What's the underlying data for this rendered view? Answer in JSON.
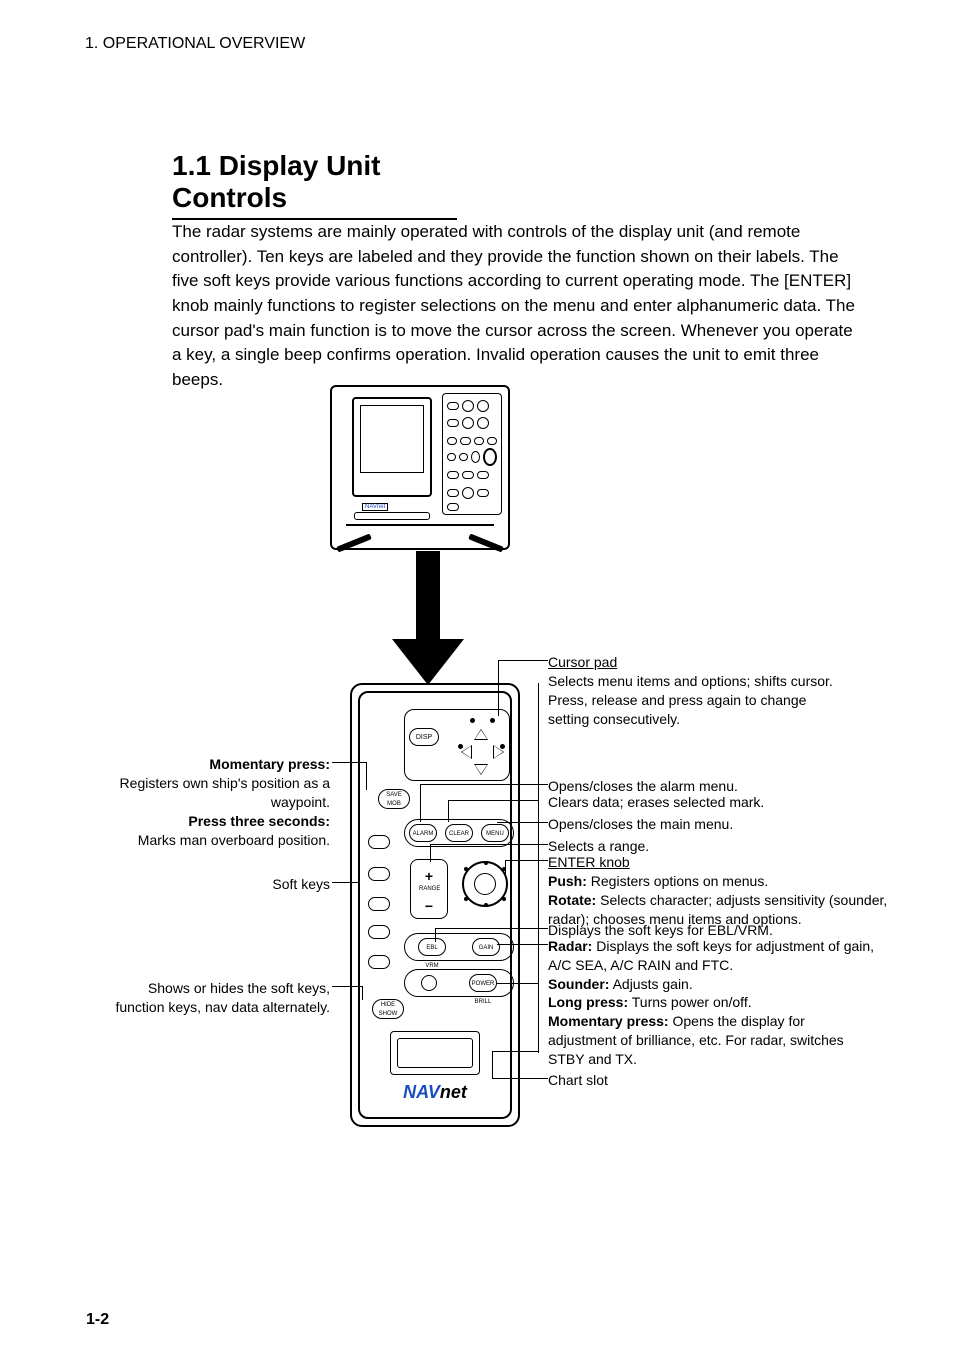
{
  "header": "1. OPERATIONAL OVERVIEW",
  "section_title": "1.1 Display Unit Controls",
  "body_text": "The radar systems are mainly operated with controls of the display unit (and remote controller). Ten keys are labeled and they provide the function shown on their labels. The five soft keys provide various functions according to current operating mode. The [ENTER] knob mainly functions to register selections on the menu and enter alphanumeric data. The cursor pad's main function is to move the cursor across the screen. Whenever you operate a key, a single beep confirms operation. Invalid operation causes the unit to emit three beeps.",
  "panel_labels": {
    "disp": "DISP",
    "save": "SAVE\nMOB",
    "alarm": "ALARM",
    "clear": "CLEAR",
    "menu": "MENU",
    "range": "RANGE",
    "ebl": "EBL\nVRM",
    "gain": "GAIN",
    "power": "POWER\nBRILL",
    "hide": "HIDE\nSHOW",
    "logo_nav": "NAV",
    "logo_net": "net",
    "small_logo": "NAVnet"
  },
  "callouts": {
    "left_mob_title": "Momentary press:",
    "left_mob_body": "Registers own ship's position as a waypoint.",
    "left_mob_title2": "Press three seconds:",
    "left_mob_body2": "Marks man overboard position.",
    "left_soft": "Soft keys",
    "left_hide": "Shows or hides the soft keys, function keys, nav data alternately.",
    "right_cursor_title": "Cursor pad",
    "right_cursor_body": "Selects menu items and options; shifts cursor. Press, release and press again to change setting consecutively.",
    "right_alarm": "Opens/closes the alarm menu.",
    "right_clear": "Clears data; erases selected mark.",
    "right_menu": "Opens/closes the main menu.",
    "right_range": "Selects a range.",
    "right_enter_title": "ENTER knob",
    "right_enter_push_b": "Push:",
    "right_enter_push": " Registers options on menus.",
    "right_enter_rot_b": "Rotate:",
    "right_enter_rot": " Selects character; adjusts sensitivity (sounder, radar); chooses menu items and options.",
    "right_ebl": "Displays the soft keys for EBL/VRM.",
    "right_gain_radar_b": "Radar:",
    "right_gain_radar": " Displays the soft keys for adjustment of gain, A/C SEA, A/C RAIN and FTC.",
    "right_gain_sound_b": "Sounder:",
    "right_gain_sound": " Adjusts gain.",
    "right_power_long_b": "Long press:",
    "right_power_long": " Turns power on/off.",
    "right_power_mom_b": "Momentary press:",
    "right_power_mom": " Opens the display for adjustment of brilliance, etc. For radar, switches STBY and TX.",
    "right_chart": "Chart slot"
  },
  "page_number": "1-2"
}
